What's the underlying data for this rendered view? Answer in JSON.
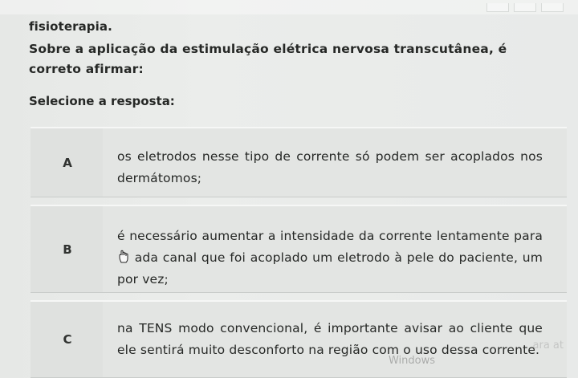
{
  "window": {
    "controls": [
      "minimize",
      "maximize",
      "close"
    ]
  },
  "question": {
    "title": "fisioterapia.",
    "body": "Sobre a aplicação da estimulação elétrica nervosa transcutânea, é correto afirmar:",
    "prompt": "Selecione a resposta:"
  },
  "options": [
    {
      "letter": "A",
      "text": "os eletrodos nesse tipo de corrente só podem ser acoplados nos dermátomos;"
    },
    {
      "letter": "B",
      "text_before_cursor": "é necessário aumentar a intensidade da corrente lentamente para",
      "text_after_cursor": "ada canal que foi acoplado um eletrodo à pele do paciente, um por vez;"
    },
    {
      "letter": "C",
      "text": "na TENS modo convencional, é importante avisar ao cliente que ele sentirá muito desconforto na região com o",
      "text_tail": "uso dessa corrente."
    }
  ],
  "overlay": {
    "watermark": "Windows",
    "ghost_text": "ara at"
  },
  "icons": {
    "cursor": "hand-pointer-icon"
  },
  "colors": {
    "background": "#e9eceb",
    "option_box": "#e3e5e3",
    "text": "#262826"
  }
}
